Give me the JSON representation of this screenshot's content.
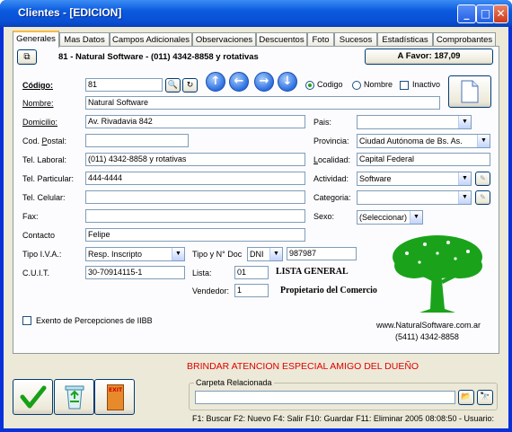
{
  "window": {
    "title": "Clientes - [EDICION]",
    "min": "_",
    "max": "□",
    "close": "✕"
  },
  "tabs": [
    "Generales",
    "Mas Datos",
    "Campos Adicionales",
    "Observaciones",
    "Descuentos",
    "Foto",
    "Sucesos",
    "Estadísticas",
    "Comprobantes"
  ],
  "header": {
    "client_line": "81 - Natural Software - (011)  4342-8858    y rotativas",
    "balance": "A Favor: 187,09"
  },
  "form": {
    "codigo_label": "Código:",
    "codigo": "81",
    "radio_codigo": "Codigo",
    "radio_nombre": "Nombre",
    "inactivo": "Inactivo",
    "nombre_label": "Nombre:",
    "nombre": "Natural Software",
    "domicilio_label": "Domicilio:",
    "domicilio": "Av. Rivadavia 842",
    "cp_label": "Cod. Postal:",
    "cp": "",
    "tel_laboral_label": "Tel. Laboral:",
    "tel_laboral": "(011)  4342-8858   y rotativas",
    "tel_particular_label": "Tel. Particular:",
    "tel_particular": "444-4444",
    "tel_celular_label": "Tel. Celular:",
    "tel_celular": "",
    "fax_label": "Fax:",
    "fax": "",
    "contacto_label": "Contacto",
    "contacto": "Felipe",
    "iva_label": "Tipo I.V.A.:",
    "iva": "Resp. Inscripto",
    "doc_label": "Tipo y N° Doc",
    "doc_tipo": "DNI",
    "doc_num": "987987",
    "cuit_label": "C.U.I.T.",
    "cuit": "30-70914115-1",
    "lista_label": "Lista:",
    "lista": "01",
    "lista_name": "LISTA GENERAL",
    "vendedor_label": "Vendedor:",
    "vendedor": "1",
    "vendedor_name": "Propietario del Comercio",
    "pais_label": "Pais:",
    "pais": "",
    "provincia_label": "Provincia:",
    "provincia": "Ciudad Autónoma de Bs. As.",
    "localidad_label": "Localidad:",
    "localidad": "Capital Federal",
    "actividad_label": "Actividad:",
    "actividad": "Software",
    "categoria_label": "Categoria:",
    "categoria": "",
    "sexo_label": "Sexo:",
    "sexo": "(Seleccionar)",
    "iibb_label": "Exento de Percepciones de IIBB"
  },
  "company": {
    "web": "www.NaturalSoftware.com.ar",
    "phone": "(5411) 4342-8858"
  },
  "banner": "BRINDAR ATENCION ESPECIAL AMIGO DEL DUEÑO",
  "carpeta": {
    "label": "Carpeta Relacionada",
    "value": ""
  },
  "bottom": {
    "exit": "EXIT"
  },
  "status": "F1: Buscar  F2: Nuevo  F4: Salir  F10: Guardar  F11: Eliminar  2005 08:08:50 - Usuario:",
  "colors": {
    "banner": "#e00000",
    "accent": "#0a5be0",
    "tree": "#1aa31a"
  }
}
